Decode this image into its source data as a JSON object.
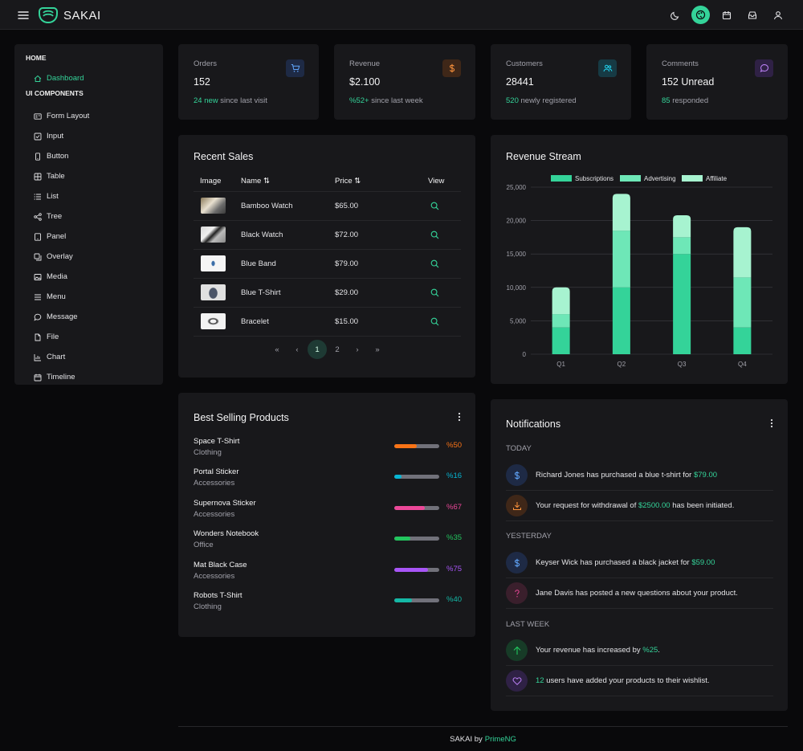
{
  "app": {
    "brand": "SAKAI"
  },
  "sidebar": {
    "home_section": "HOME",
    "dashboard": "Dashboard",
    "ui_section": "UI COMPONENTS",
    "items": [
      "Form Layout",
      "Input",
      "Button",
      "Table",
      "List",
      "Tree",
      "Panel",
      "Overlay",
      "Media",
      "Menu",
      "Message",
      "File",
      "Chart",
      "Timeline"
    ]
  },
  "stats": [
    {
      "title": "Orders",
      "value": "152",
      "accent": "24 new",
      "rest": " since last visit",
      "icon": "cart-icon",
      "color": "#60a5fa",
      "bg": "#1e2a45"
    },
    {
      "title": "Revenue",
      "value": "$2.100",
      "accent": "%52+",
      "rest": " since last week",
      "icon": "dollar-icon",
      "color": "#fb923c",
      "bg": "#3f2718"
    },
    {
      "title": "Customers",
      "value": "28441",
      "accent": "520",
      "rest": " newly registered",
      "icon": "users-icon",
      "color": "#22d3ee",
      "bg": "#163a44"
    },
    {
      "title": "Comments",
      "value": "152 Unread",
      "accent": "85",
      "rest": " responded",
      "icon": "comment-icon",
      "color": "#c084fc",
      "bg": "#2f2145"
    }
  ],
  "recent_sales": {
    "title": "Recent Sales",
    "headers": {
      "image": "Image",
      "name": "Name",
      "price": "Price",
      "view": "View"
    },
    "rows": [
      {
        "name": "Bamboo Watch",
        "price": "$65.00"
      },
      {
        "name": "Black Watch",
        "price": "$72.00"
      },
      {
        "name": "Blue Band",
        "price": "$79.00"
      },
      {
        "name": "Blue T-Shirt",
        "price": "$29.00"
      },
      {
        "name": "Bracelet",
        "price": "$15.00"
      }
    ],
    "pages": [
      "1",
      "2"
    ]
  },
  "revenue": {
    "title": "Revenue Stream"
  },
  "chart_data": {
    "type": "bar",
    "stacked": true,
    "title": "Revenue Stream",
    "categories": [
      "Q1",
      "Q2",
      "Q3",
      "Q4"
    ],
    "series": [
      {
        "name": "Subscriptions",
        "values": [
          4000,
          10000,
          15000,
          4000
        ],
        "color": "#34d399"
      },
      {
        "name": "Advertising",
        "values": [
          2000,
          8500,
          2500,
          7500
        ],
        "color": "#6ee7b7"
      },
      {
        "name": "Affiliate",
        "values": [
          4000,
          5500,
          3300,
          7500
        ],
        "color": "#a7f3d0"
      }
    ],
    "ylim": [
      0,
      25000
    ],
    "yticks": [
      "0",
      "5,000",
      "10,000",
      "15,000",
      "20,000",
      "25,000"
    ],
    "grid": true,
    "legend": "top"
  },
  "best_selling": {
    "title": "Best Selling Products",
    "products": [
      {
        "name": "Space T-Shirt",
        "category": "Clothing",
        "percent": "%50",
        "value": 50,
        "color": "#f97316"
      },
      {
        "name": "Portal Sticker",
        "category": "Accessories",
        "percent": "%16",
        "value": 16,
        "color": "#06b6d4"
      },
      {
        "name": "Supernova Sticker",
        "category": "Accessories",
        "percent": "%67",
        "value": 67,
        "color": "#ec4899"
      },
      {
        "name": "Wonders Notebook",
        "category": "Office",
        "percent": "%35",
        "value": 35,
        "color": "#22c55e"
      },
      {
        "name": "Mat Black Case",
        "category": "Accessories",
        "percent": "%75",
        "value": 75,
        "color": "#a855f7"
      },
      {
        "name": "Robots T-Shirt",
        "category": "Clothing",
        "percent": "%40",
        "value": 40,
        "color": "#14b8a6"
      }
    ]
  },
  "notifications": {
    "title": "Notifications",
    "today": "TODAY",
    "yesterday": "YESTERDAY",
    "last_week": "LAST WEEK",
    "n1": {
      "text": "Richard Jones has purchased a blue t-shirt for ",
      "accent": "$79.00",
      "icon": "dollar-icon"
    },
    "n2": {
      "pre": "Your request for withdrawal of ",
      "accent": "$2500.00",
      "post": " has been initiated.",
      "icon": "download-icon"
    },
    "n3": {
      "text": "Keyser Wick has purchased a black jacket for ",
      "accent": "$59.00",
      "icon": "dollar-icon"
    },
    "n4": {
      "text": "Jane Davis has posted a new questions about your product.",
      "icon": "question-icon"
    },
    "n5": {
      "text": "Your revenue has increased by ",
      "accent": "%25",
      "post": ".",
      "icon": "arrow-up-icon"
    },
    "n6": {
      "accent": "12",
      "text": " users have added your products to their wishlist.",
      "icon": "heart-icon"
    }
  },
  "footer": {
    "text": "SAKAI by",
    "link": "PrimeNG"
  }
}
